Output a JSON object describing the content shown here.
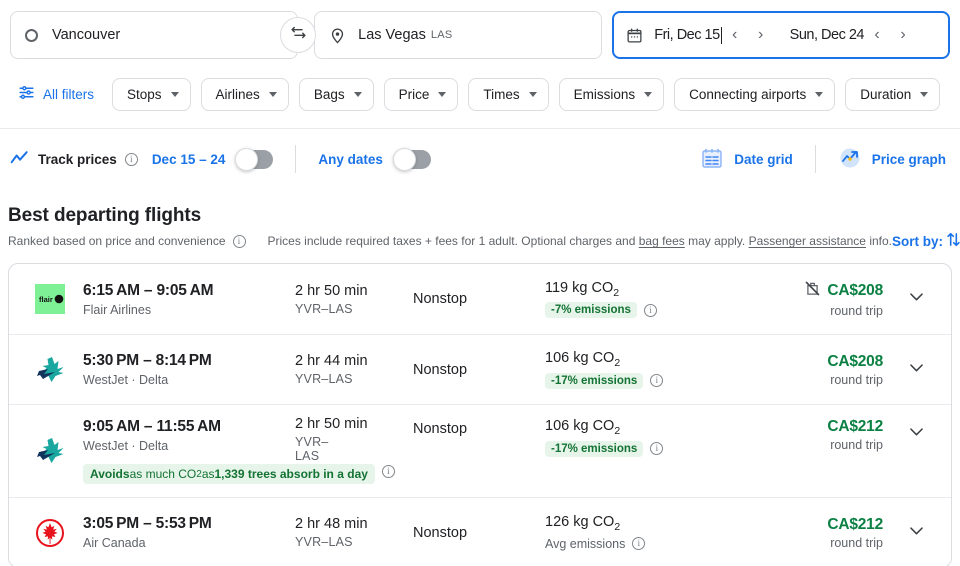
{
  "search": {
    "origin": {
      "icon": "circle-icon",
      "value": "Vancouver"
    },
    "swap_icon": "swap-arrows-icon",
    "destination": {
      "icon": "location-pin-icon",
      "value": "Las Vegas",
      "code": "LAS"
    },
    "dates": {
      "calendar_icon": "calendar-icon",
      "depart": "Fri, Dec 15",
      "depart_prev": "‹",
      "depart_next": "›",
      "return": "Sun, Dec 24",
      "return_prev": "‹",
      "return_next": "›"
    }
  },
  "filters": {
    "all_filters_icon": "tune-filters-icon",
    "all_filters_label": "All filters",
    "chips": [
      {
        "label": "Stops"
      },
      {
        "label": "Airlines"
      },
      {
        "label": "Bags"
      },
      {
        "label": "Price"
      },
      {
        "label": "Times"
      },
      {
        "label": "Emissions"
      },
      {
        "label": "Connecting airports"
      },
      {
        "label": "Duration"
      }
    ]
  },
  "track": {
    "chart_icon": "trending-line-icon",
    "label": "Track prices",
    "info_icon": "info-icon",
    "date_range_label": "Dec 15 – 24",
    "date_range_toggle_state": "off",
    "any_dates_label": "Any dates",
    "any_dates_toggle_state": "off",
    "date_grid_icon": "date-grid-icon",
    "date_grid_label": "Date grid",
    "price_graph_icon": "price-graph-icon",
    "price_graph_label": "Price graph"
  },
  "section": {
    "title": "Best departing flights",
    "ranked_note": "Ranked based on price and convenience",
    "ranked_info_icon": "info-icon",
    "fees_note_a": "Prices include required taxes + fees for 1 adult. Optional charges and ",
    "fees_link_1": "bag fees",
    "fees_note_b": " may apply. ",
    "fees_link_2": "Passenger assistance",
    "fees_note_c": " info.",
    "sort_label": "Sort by:",
    "sort_icon": "sort-arrows-icon"
  },
  "flights": [
    {
      "airline_logo": "flair-airlines-logo",
      "times": "6:15 AM – 9:05 AM",
      "airline": "Flair Airlines",
      "duration": "2 hr 50 min",
      "route": "YVR–LAS",
      "stops": "Nonstop",
      "co2": "119 kg CO",
      "co2_sub": "2",
      "emissions_badge": "-7% emissions",
      "emissions_badge_style": "green",
      "emissions_info_icon": "info-icon",
      "no_bag_icon": "no-carry-on-bag-icon",
      "price": "CA$208",
      "price_note": "round trip",
      "expand_icon": "chevron-down-icon",
      "trees_badge": null
    },
    {
      "airline_logo": "westjet-logo",
      "times": "5:30 PM – 8:14 PM",
      "airline": "WestJet · Delta",
      "duration": "2 hr 44 min",
      "route": "YVR–LAS",
      "stops": "Nonstop",
      "co2": "106 kg CO",
      "co2_sub": "2",
      "emissions_badge": "-17% emissions",
      "emissions_badge_style": "green",
      "emissions_info_icon": "info-icon",
      "no_bag_icon": null,
      "price": "CA$208",
      "price_note": "round trip",
      "expand_icon": "chevron-down-icon",
      "trees_badge": null
    },
    {
      "airline_logo": "westjet-logo",
      "times": "9:05 AM – 11:55 AM",
      "airline": "WestJet · Delta",
      "duration": "2 hr 50 min",
      "route": "YVR–LAS",
      "stops": "Nonstop",
      "co2": "106 kg CO",
      "co2_sub": "2",
      "emissions_badge": "-17% emissions",
      "emissions_badge_style": "green",
      "emissions_info_icon": "info-icon",
      "no_bag_icon": null,
      "price": "CA$212",
      "price_note": "round trip",
      "expand_icon": "chevron-down-icon",
      "trees_badge": {
        "lead": "Avoids",
        "mid": " as much CO",
        "mid_sub": "2",
        "mid2": " as ",
        "strong": "1,339 trees absorb in a day",
        "info_icon": "info-icon"
      }
    },
    {
      "airline_logo": "air-canada-logo",
      "times": "3:05 PM – 5:53 PM",
      "airline": "Air Canada",
      "duration": "2 hr 48 min",
      "route": "YVR–LAS",
      "stops": "Nonstop",
      "co2": "126 kg CO",
      "co2_sub": "2",
      "emissions_badge": "Avg emissions",
      "emissions_badge_style": "plain",
      "emissions_info_icon": "info-icon",
      "no_bag_icon": null,
      "price": "CA$212",
      "price_note": "round trip",
      "expand_icon": "chevron-down-icon",
      "trees_badge": null
    }
  ],
  "colors": {
    "accent_blue": "#1a73e8",
    "price_green": "#0b8043",
    "badge_green_bg": "#e6f4ea",
    "badge_green_fg": "#137333",
    "border": "#dadce0",
    "text_secondary": "#5f6368"
  }
}
